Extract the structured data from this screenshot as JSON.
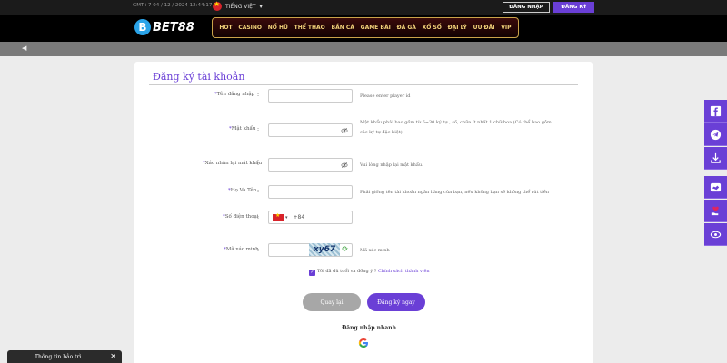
{
  "topbar": {
    "time": "GMT+7 04 / 12 / 2024 12:44:17",
    "language": "TIẾNG VIỆT",
    "login_label": "ĐĂNG NHẬP",
    "register_label": "ĐĂNG KÝ"
  },
  "header": {
    "logo_letter": "B",
    "logo_text": "BET88",
    "nav": [
      "HOT",
      "CASINO",
      "NỔ HŨ",
      "THỂ THAO",
      "BẮN CÁ",
      "GAME BÀI",
      "ĐÁ GÀ",
      "XỔ SỐ",
      "ĐẠI LÝ",
      "ƯU ĐÃI",
      "VIP"
    ]
  },
  "form": {
    "title": "Đăng ký tài khoản",
    "username": {
      "label": "Tên đăng nhập",
      "value": "",
      "hint": "Please enter player id"
    },
    "password": {
      "label": "Mật khẩu",
      "value": "",
      "hint": "Mật khẩu phải bao gồm từ 6~30 ký tự , số, chữa ít nhất 1 chữ hoa (Có thể bao gồm các ký tự đặc biệt)"
    },
    "confirm": {
      "label": "Xác nhận lại mật khẩu",
      "value": "",
      "hint": "Vui lòng nhập lại mật khẩu."
    },
    "fullname": {
      "label": "Họ Và Tên",
      "value": "",
      "hint": "Phải giống tên tài khoản ngân hàng của bạn, nếu không bạn sẽ không thể rút tiền"
    },
    "phone": {
      "label": "Số điện thoại",
      "prefix": "+84",
      "value": ""
    },
    "captcha": {
      "label": "Mã xác minh",
      "code": "xy67",
      "hint": "Mã xác minh"
    },
    "agree_text": "Tôi đã đủ tuổi và đồng ý",
    "agree_link": "Chính sách thành viên",
    "back_label": "Quay lại",
    "submit_label": "Đăng ký ngay",
    "quick_login": "Đăng nhập nhanh",
    "colon": ":",
    "required_mark": "*"
  },
  "notice": {
    "label": "Thông tin bảo trì",
    "close": "✕"
  },
  "social": [
    "facebook-icon",
    "telegram-icon",
    "download-icon",
    "handshake-icon",
    "heart-hand-icon",
    "eye-icon"
  ],
  "colors": {
    "accent": "#6a3fd6",
    "nav_text": "#f3d27a",
    "logo_blue": "#2aa3e8"
  }
}
